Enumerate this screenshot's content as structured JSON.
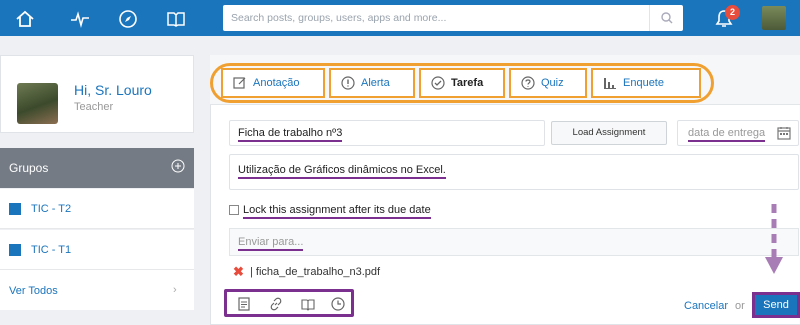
{
  "colors": {
    "brand": "#1b75bc",
    "highlight_orange": "#f0a030",
    "annotation_purple": "#7b2f8e",
    "alert_red": "#e74c3c"
  },
  "topbar": {
    "icons": [
      "home-icon",
      "activity-icon",
      "compass-icon",
      "book-icon"
    ],
    "search_placeholder": "Search posts, groups, users, apps and more...",
    "notification_count": "2"
  },
  "sidebar": {
    "greeting": "Hi, Sr. Louro",
    "role": "Teacher",
    "groups_title": "Grupos",
    "groups": [
      {
        "label": "TIC - T2"
      },
      {
        "label": "TIC - T1"
      }
    ],
    "see_all": "Ver Todos",
    "see_all_chevron": "›"
  },
  "tabs": [
    {
      "label": "Anotação",
      "icon": "edit-icon"
    },
    {
      "label": "Alerta",
      "icon": "alert-icon"
    },
    {
      "label": "Tarefa",
      "icon": "check-icon"
    },
    {
      "label": "Quiz",
      "icon": "question-icon"
    },
    {
      "label": "Enquete",
      "icon": "poll-icon"
    }
  ],
  "form": {
    "title_value": "Ficha de trabalho nº3",
    "load_button": "Load Assignment",
    "due_placeholder": "data de entrega",
    "description_value": "Utilização de Gráficos dinâmicos no Excel.",
    "lock_label": "Lock this assignment after its due date",
    "send_to_placeholder": "Enviar para...",
    "attachment_mark": "✖",
    "attachment": "| ficha_de_trabalho_n3.pdf",
    "cancel": "Cancelar",
    "or": "or",
    "send": "Send"
  }
}
